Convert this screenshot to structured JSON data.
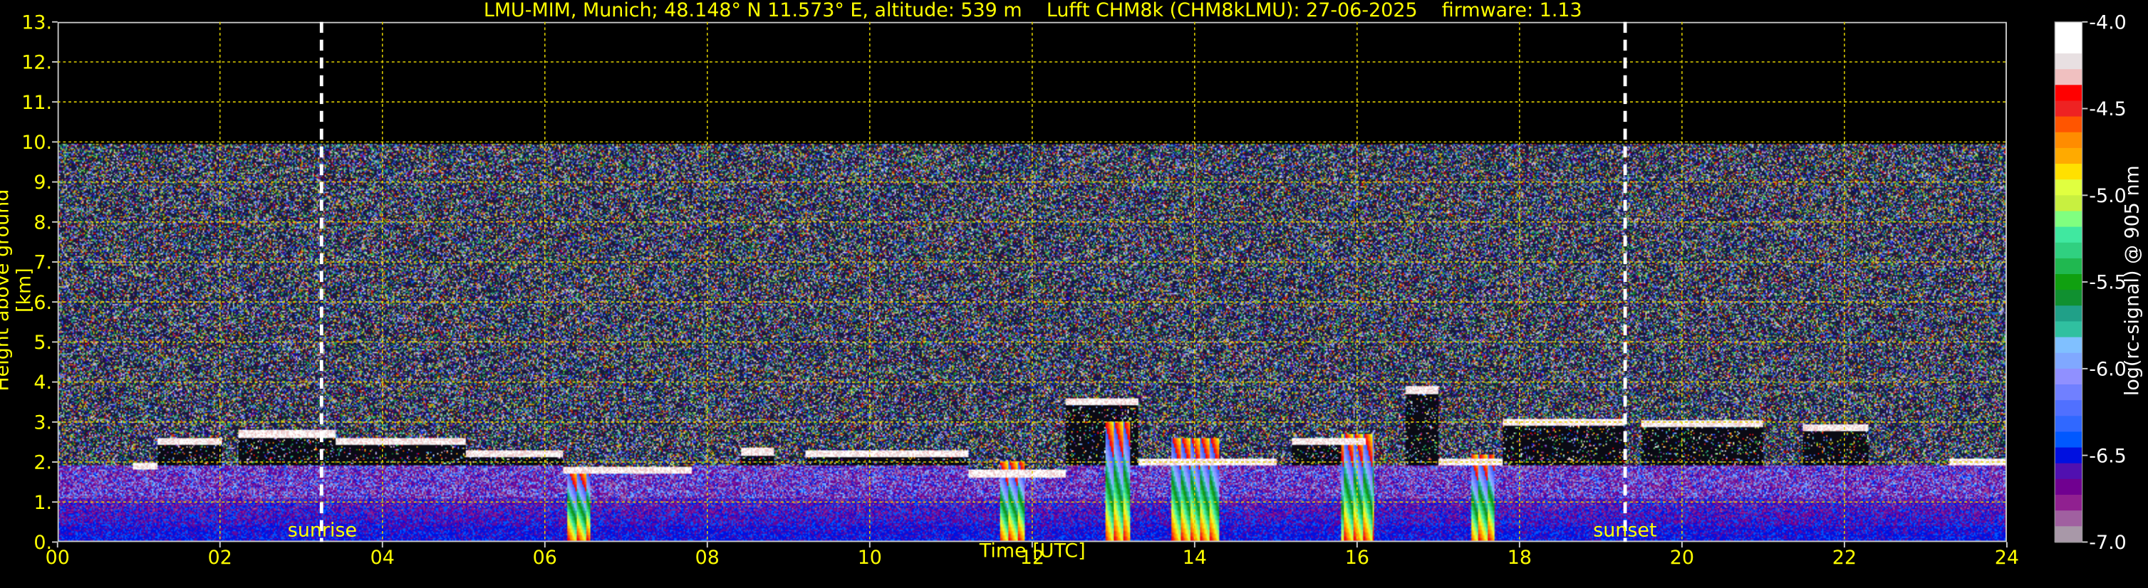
{
  "title": "LMU-MIM, Munich; 48.148° N 11.573° E, altitude: 539 m    Lufft CHM8k (CHM8kLMU): 27-06-2025    firmware: 1.13",
  "chart_data": {
    "type": "heatmap",
    "title": "LMU-MIM, Munich; 48.148° N 11.573° E, altitude: 539 m    Lufft CHM8k (CHM8kLMU): 27-06-2025    firmware: 1.13",
    "xlabel": "Time [UTC]",
    "ylabel": "Height above ground [km]",
    "xlim": [
      0,
      24
    ],
    "ylim": [
      0,
      13
    ],
    "x_ticks": [
      "00",
      "02",
      "04",
      "06",
      "08",
      "10",
      "12",
      "14",
      "16",
      "18",
      "20",
      "22",
      "24"
    ],
    "y_ticks": [
      "0.",
      "1.",
      "2.",
      "3.",
      "4.",
      "5.",
      "6.",
      "7.",
      "8.",
      "9.",
      "10.",
      "11.",
      "12.",
      "13."
    ],
    "grid": true,
    "data_top_km": 10,
    "annotations": [
      {
        "label": "sunrise",
        "time_h": 3.25
      },
      {
        "label": "sunset",
        "time_h": 19.3
      }
    ],
    "colorbar": {
      "label": "log(rc-signal) @ 905 nm",
      "range": [
        -7.0,
        -4.0
      ],
      "ticks": [
        "-4.0",
        "-4.5",
        "-5.0",
        "-5.5",
        "-6.0",
        "-6.5",
        "-7.0"
      ],
      "colors": [
        "#ffffff",
        "#ffffff",
        "#e8e0e2",
        "#f0c0c0",
        "#ff0000",
        "#ee2222",
        "#ff5500",
        "#ff8c00",
        "#ffaa00",
        "#ffe000",
        "#e0ff40",
        "#c8f040",
        "#80ff80",
        "#40e8a0",
        "#30d080",
        "#20b850",
        "#10a010",
        "#109030",
        "#20a088",
        "#30c0a0",
        "#80c0ff",
        "#80a8ff",
        "#9090ff",
        "#7080ff",
        "#5070ff",
        "#3068ff",
        "#0058ff",
        "#0010e0",
        "#5010b0",
        "#700090",
        "#902090",
        "#a060a0",
        "#a898a8"
      ]
    },
    "cloud_layers_km": [
      {
        "t": [
          0.9,
          1.2
        ],
        "h": 1.9
      },
      {
        "t": [
          1.2,
          2.0
        ],
        "h": 2.5
      },
      {
        "t": [
          2.2,
          3.4
        ],
        "h": 2.7
      },
      {
        "t": [
          3.4,
          5.0
        ],
        "h": 2.5
      },
      {
        "t": [
          5.0,
          6.2
        ],
        "h": 2.2
      },
      {
        "t": [
          6.2,
          7.8
        ],
        "h": 1.8
      },
      {
        "t": [
          8.4,
          8.8
        ],
        "h": 2.25
      },
      {
        "t": [
          9.2,
          11.2
        ],
        "h": 2.2
      },
      {
        "t": [
          11.2,
          12.4
        ],
        "h": 1.7
      },
      {
        "t": [
          12.4,
          13.3
        ],
        "h": 3.5
      },
      {
        "t": [
          13.3,
          15.0
        ],
        "h": 2.0
      },
      {
        "t": [
          15.2,
          16.1
        ],
        "h": 2.5
      },
      {
        "t": [
          16.6,
          17.0
        ],
        "h": 3.8
      },
      {
        "t": [
          17.0,
          17.8
        ],
        "h": 2.0
      },
      {
        "t": [
          17.8,
          19.3
        ],
        "h": 3.0
      },
      {
        "t": [
          19.5,
          21.0
        ],
        "h": 2.95
      },
      {
        "t": [
          21.5,
          22.3
        ],
        "h": 2.85
      },
      {
        "t": [
          23.3,
          24.0
        ],
        "h": 2.0
      }
    ],
    "precipitation_columns": [
      {
        "t": [
          6.25,
          6.55
        ],
        "top_km": 1.8
      },
      {
        "t": [
          11.6,
          11.9
        ],
        "top_km": 2.0
      },
      {
        "t": [
          12.9,
          13.2
        ],
        "top_km": 3.0
      },
      {
        "t": [
          13.7,
          14.3
        ],
        "top_km": 2.6
      },
      {
        "t": [
          15.8,
          16.2
        ],
        "top_km": 2.7
      },
      {
        "t": [
          17.4,
          17.7
        ],
        "top_km": 2.2
      }
    ]
  },
  "sunrise_label": "sunrise",
  "sunset_label": "sunset"
}
